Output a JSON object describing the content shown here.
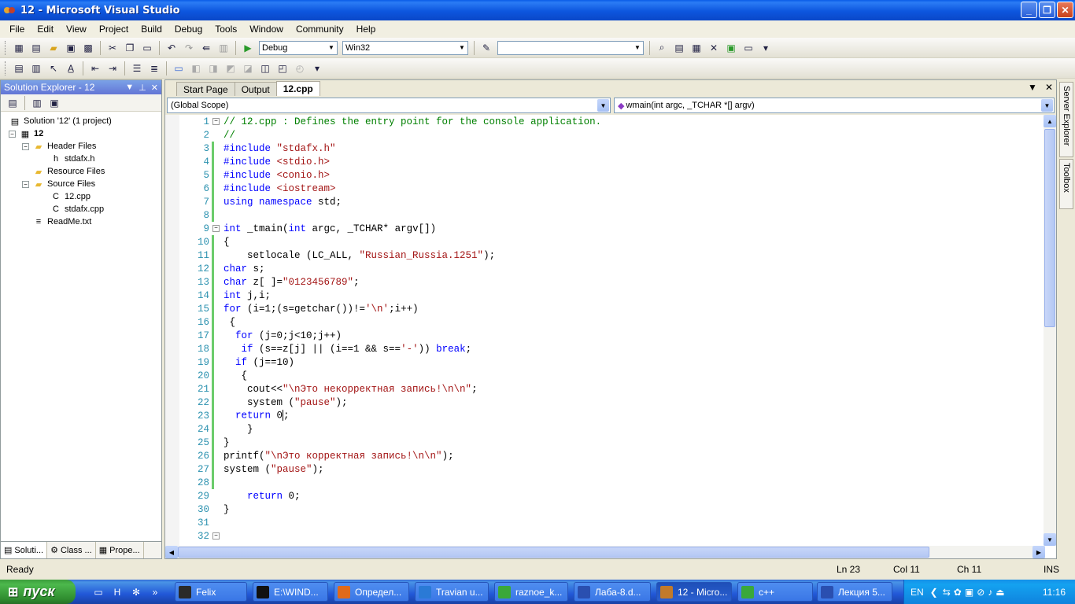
{
  "window": {
    "title": "12 - Microsoft Visual Studio",
    "min_label": "_",
    "max_label": "❐",
    "close_label": "✕"
  },
  "menu": [
    "File",
    "Edit",
    "View",
    "Project",
    "Build",
    "Debug",
    "Tools",
    "Window",
    "Community",
    "Help"
  ],
  "toolbar": {
    "config": "Debug",
    "platform": "Win32",
    "find_value": ""
  },
  "solution_explorer": {
    "title": "Solution Explorer - 12",
    "tree": [
      {
        "label": "Solution '12' (1 project)",
        "level": 0,
        "icon": "solution-icon",
        "expander": ""
      },
      {
        "label": "12",
        "level": 0,
        "icon": "project-icon",
        "expander": "−",
        "bold": true
      },
      {
        "label": "Header Files",
        "level": 1,
        "icon": "folder-icon",
        "expander": "−"
      },
      {
        "label": "stdafx.h",
        "level": 2,
        "icon": "h-file-icon",
        "expander": ""
      },
      {
        "label": "Resource Files",
        "level": 1,
        "icon": "folder-icon",
        "expander": ""
      },
      {
        "label": "Source Files",
        "level": 1,
        "icon": "folder-icon",
        "expander": "−"
      },
      {
        "label": "12.cpp",
        "level": 2,
        "icon": "cpp-file-icon",
        "expander": ""
      },
      {
        "label": "stdafx.cpp",
        "level": 2,
        "icon": "cpp-file-icon",
        "expander": ""
      },
      {
        "label": "ReadMe.txt",
        "level": 1,
        "icon": "txt-file-icon",
        "expander": ""
      }
    ],
    "tabs": [
      "Soluti...",
      "Class ...",
      "Prope..."
    ]
  },
  "doc_tabs": [
    "Start Page",
    "Output",
    "12.cpp"
  ],
  "active_doc_tab": "12.cpp",
  "nav": {
    "scope": "(Global Scope)",
    "member": "wmain(int argc, _TCHAR *[] argv)"
  },
  "code_lines": [
    {
      "n": "1",
      "fold": "−",
      "mod": false,
      "tokens": [
        [
          "cm",
          "// 12.cpp : Defines the entry point for the console application."
        ]
      ]
    },
    {
      "n": "2",
      "fold": "",
      "mod": false,
      "tokens": [
        [
          "cm",
          "//"
        ]
      ]
    },
    {
      "n": "3",
      "fold": "",
      "mod": true,
      "tokens": [
        [
          "pp",
          "#include "
        ],
        [
          "st",
          "\"stdafx.h\""
        ]
      ]
    },
    {
      "n": "4",
      "fold": "",
      "mod": true,
      "tokens": [
        [
          "pp",
          "#include "
        ],
        [
          "st",
          "<stdio.h>"
        ]
      ]
    },
    {
      "n": "5",
      "fold": "",
      "mod": true,
      "tokens": [
        [
          "pp",
          "#include "
        ],
        [
          "st",
          "<conio.h>"
        ]
      ]
    },
    {
      "n": "6",
      "fold": "",
      "mod": true,
      "tokens": [
        [
          "pp",
          "#include "
        ],
        [
          "st",
          "<iostream>"
        ]
      ]
    },
    {
      "n": "7",
      "fold": "",
      "mod": true,
      "tokens": [
        [
          "kw",
          "using namespace "
        ],
        [
          "pl",
          "std;"
        ]
      ]
    },
    {
      "n": "8",
      "fold": "",
      "mod": true,
      "tokens": []
    },
    {
      "n": "9",
      "fold": "−",
      "mod": false,
      "tokens": [
        [
          "kw",
          "int "
        ],
        [
          "pl",
          "_tmain("
        ],
        [
          "kw",
          "int "
        ],
        [
          "pl",
          "argc, _TCHAR* argv[])"
        ]
      ]
    },
    {
      "n": "10",
      "fold": "",
      "mod": true,
      "tokens": [
        [
          "pl",
          "{"
        ]
      ]
    },
    {
      "n": "11",
      "fold": "",
      "mod": true,
      "tokens": [
        [
          "pl",
          "    setlocale (LC_ALL, "
        ],
        [
          "st",
          "\"Russian_Russia.1251\""
        ],
        [
          "pl",
          ");"
        ]
      ]
    },
    {
      "n": "12",
      "fold": "",
      "mod": true,
      "tokens": [
        [
          "kw",
          "char "
        ],
        [
          "pl",
          "s;"
        ]
      ]
    },
    {
      "n": "13",
      "fold": "",
      "mod": true,
      "tokens": [
        [
          "kw",
          "char "
        ],
        [
          "pl",
          "z[ ]="
        ],
        [
          "st",
          "\"0123456789\""
        ],
        [
          "pl",
          ";"
        ]
      ]
    },
    {
      "n": "14",
      "fold": "",
      "mod": true,
      "tokens": [
        [
          "kw",
          "int "
        ],
        [
          "pl",
          "j,i;"
        ]
      ]
    },
    {
      "n": "15",
      "fold": "",
      "mod": true,
      "tokens": [
        [
          "kw",
          "for "
        ],
        [
          "pl",
          "(i=1;(s=getchar())!="
        ],
        [
          "st",
          "'\\n'"
        ],
        [
          "pl",
          ";i++)"
        ]
      ]
    },
    {
      "n": "16",
      "fold": "",
      "mod": true,
      "tokens": [
        [
          "pl",
          " {"
        ]
      ]
    },
    {
      "n": "17",
      "fold": "",
      "mod": true,
      "tokens": [
        [
          "pl",
          "  "
        ],
        [
          "kw",
          "for "
        ],
        [
          "pl",
          "(j=0;j<10;j++)"
        ]
      ]
    },
    {
      "n": "18",
      "fold": "",
      "mod": true,
      "tokens": [
        [
          "pl",
          "   "
        ],
        [
          "kw",
          "if "
        ],
        [
          "pl",
          "(s==z[j] || (i==1 && s=="
        ],
        [
          "st",
          "'-'"
        ],
        [
          "pl",
          ")) "
        ],
        [
          "kw",
          "break"
        ],
        [
          "pl",
          ";"
        ]
      ]
    },
    {
      "n": "19",
      "fold": "",
      "mod": true,
      "tokens": [
        [
          "pl",
          "  "
        ],
        [
          "kw",
          "if "
        ],
        [
          "pl",
          "(j==10)"
        ]
      ]
    },
    {
      "n": "20",
      "fold": "",
      "mod": true,
      "tokens": [
        [
          "pl",
          "   {"
        ]
      ]
    },
    {
      "n": "21",
      "fold": "",
      "mod": true,
      "tokens": [
        [
          "pl",
          "    cout<<"
        ],
        [
          "st",
          "\"\\nЭто некорректная запись!\\n\\n\""
        ],
        [
          "pl",
          ";"
        ]
      ]
    },
    {
      "n": "22",
      "fold": "",
      "mod": true,
      "tokens": [
        [
          "pl",
          "    system ("
        ],
        [
          "st",
          "\"pause\""
        ],
        [
          "pl",
          ");"
        ]
      ]
    },
    {
      "n": "23",
      "fold": "",
      "mod": true,
      "tokens": [
        [
          "pl",
          "  "
        ],
        [
          "kw",
          "return "
        ],
        [
          "pl",
          "0"
        ],
        [
          "caret",
          ""
        ],
        [
          "pl",
          ";"
        ]
      ]
    },
    {
      "n": "24",
      "fold": "",
      "mod": true,
      "tokens": [
        [
          "pl",
          "    }"
        ]
      ]
    },
    {
      "n": "25",
      "fold": "",
      "mod": true,
      "tokens": [
        [
          "pl",
          "}"
        ]
      ]
    },
    {
      "n": "26",
      "fold": "",
      "mod": true,
      "tokens": [
        [
          "pl",
          "printf("
        ],
        [
          "st",
          "\"\\nЭто корректная запись!\\n\\n\""
        ],
        [
          "pl",
          ");"
        ]
      ]
    },
    {
      "n": "27",
      "fold": "",
      "mod": true,
      "tokens": [
        [
          "pl",
          "system ("
        ],
        [
          "st",
          "\"pause\""
        ],
        [
          "pl",
          ");"
        ]
      ]
    },
    {
      "n": "28",
      "fold": "",
      "mod": true,
      "tokens": []
    },
    {
      "n": "29",
      "fold": "",
      "mod": false,
      "tokens": [
        [
          "pl",
          "    "
        ],
        [
          "kw",
          "return "
        ],
        [
          "pl",
          "0;"
        ]
      ]
    },
    {
      "n": "30",
      "fold": "",
      "mod": false,
      "tokens": [
        [
          "pl",
          "}"
        ]
      ]
    },
    {
      "n": "31",
      "fold": "",
      "mod": false,
      "tokens": []
    },
    {
      "n": "32",
      "fold": "−",
      "mod": false,
      "tokens": []
    }
  ],
  "side_tabs": [
    "Server Explorer",
    "Toolbox"
  ],
  "status": {
    "text": "Ready",
    "ln": "Ln 23",
    "col": "Col 11",
    "ch": "Ch 11",
    "mode": "INS"
  },
  "taskbar": {
    "start": "пуск",
    "items": [
      {
        "label": "Felix",
        "icon": "felix-icon",
        "active": false
      },
      {
        "label": "E:\\WIND...",
        "icon": "console-icon",
        "active": false
      },
      {
        "label": "Определ...",
        "icon": "firefox-icon",
        "active": false
      },
      {
        "label": "Travian u...",
        "icon": "ie-icon",
        "active": false
      },
      {
        "label": "raznoe_k...",
        "icon": "icq-icon",
        "active": false
      },
      {
        "label": "Лаба-8.d...",
        "icon": "word-icon",
        "active": false
      },
      {
        "label": "12 - Micro...",
        "icon": "vs-icon",
        "active": true
      },
      {
        "label": "c++",
        "icon": "icq-icon",
        "active": false
      },
      {
        "label": "Лекция 5...",
        "icon": "word-icon",
        "active": false
      }
    ],
    "lang": "EN",
    "clock": "11:16"
  },
  "colors": {
    "keyword": "#0000ff",
    "comment": "#008000",
    "string": "#a31515",
    "line_number": "#2b91af",
    "change_bar": "#6ccc6c"
  }
}
